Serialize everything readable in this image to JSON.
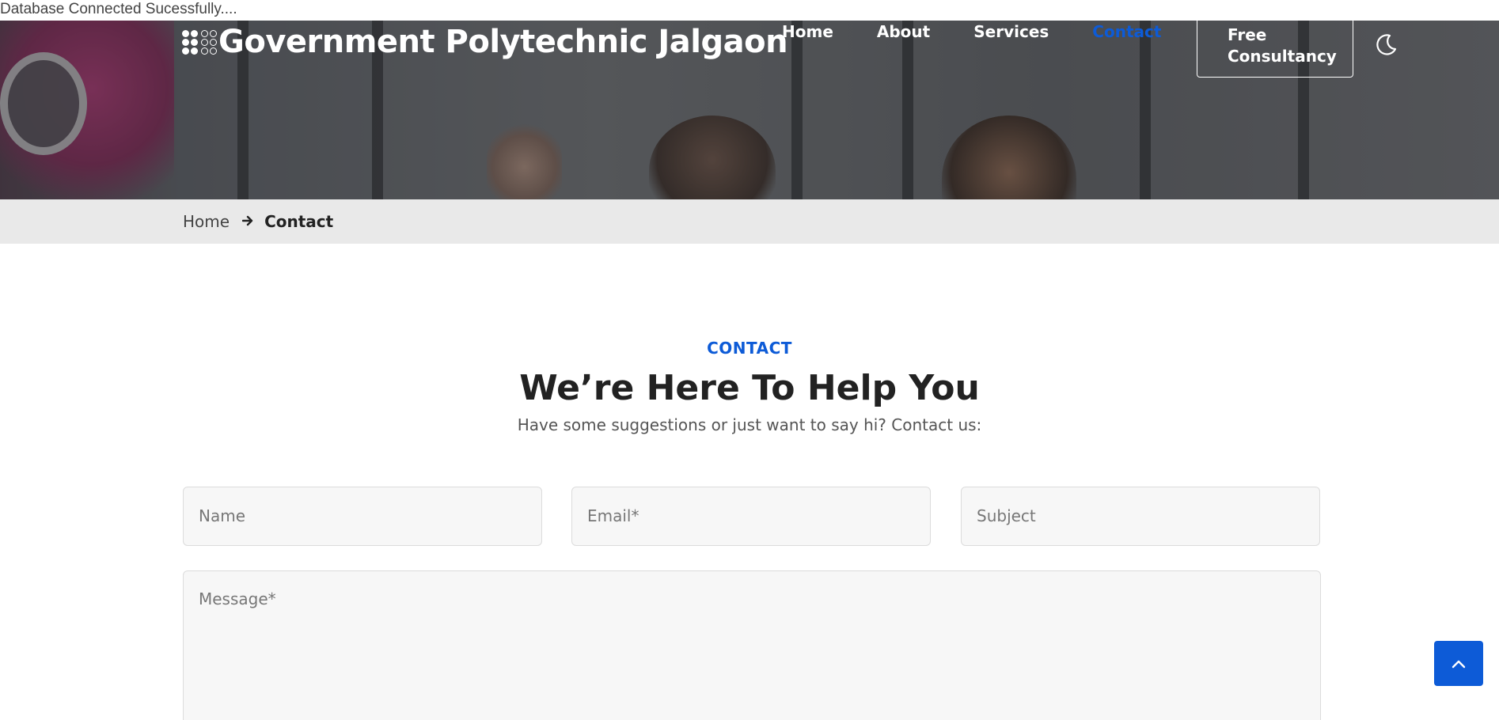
{
  "status_message": "Database Connected Sucessfully....",
  "brand": {
    "name": "Government Polytechnic Jalgaon",
    "icon": "dot-grid-logo-icon"
  },
  "nav": {
    "items": [
      {
        "label": "Home",
        "active": false
      },
      {
        "label": "About",
        "active": false
      },
      {
        "label": "Services",
        "active": false
      },
      {
        "label": "Contact",
        "active": true
      }
    ],
    "cta_line1": "Free",
    "cta_line2": "Consultancy",
    "theme_toggle_icon": "moon-icon"
  },
  "breadcrumb": {
    "home": "Home",
    "separator_icon": "arrow-right-icon",
    "current": "Contact"
  },
  "contact_section": {
    "tag": "CONTACT",
    "title": "We’re Here To Help You",
    "subtitle": "Have some suggestions or just want to say hi? Contact us:"
  },
  "form": {
    "name_placeholder": "Name",
    "email_placeholder": "Email*",
    "subject_placeholder": "Subject",
    "message_placeholder": "Message*"
  },
  "back_to_top_icon": "chevron-up-icon",
  "colors": {
    "accent": "#0d5bd7",
    "breadcrumb_bg": "#e9e9e9",
    "field_bg": "#f7f7f7"
  }
}
